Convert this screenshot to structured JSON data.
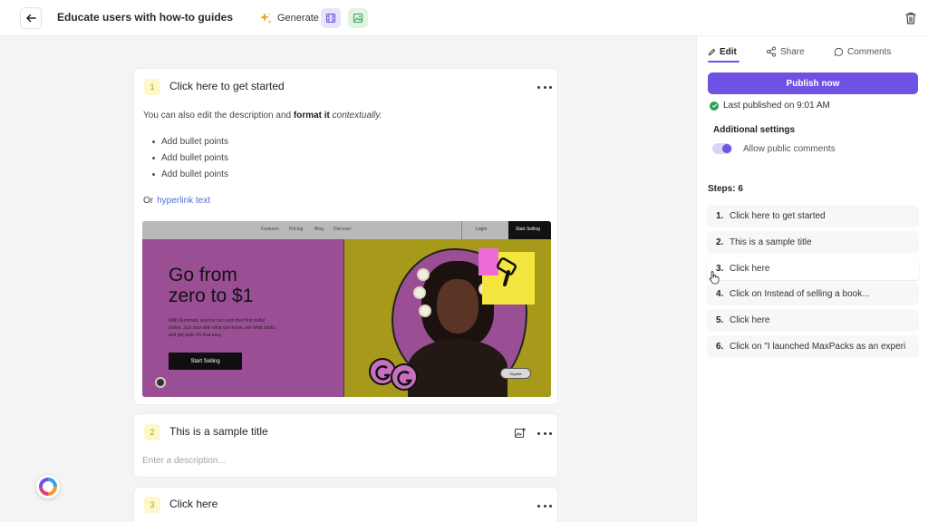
{
  "header": {
    "title": "Educate users with how-to guides",
    "generate_label": "Generate"
  },
  "steps_content": [
    {
      "number": "1",
      "title": "Click here to get started",
      "description_prefix": "You can also edit the description and",
      "description_bold": "format it",
      "description_italic": "contextually.",
      "bullets": [
        "Add bullet points",
        "Add bullet points",
        "Add bullet points"
      ],
      "or_text": "Or",
      "link_text": "hyperlink text",
      "screenshot": {
        "nav_items": [
          "Features",
          "Pricing",
          "Blog",
          "Discover"
        ],
        "login": "Login",
        "start_selling_nav": "Start Selling",
        "headline_line1": "Go from",
        "headline_line2": "zero to $1",
        "body_lines": [
          "With Gumroad, anyone can earn their first dollar",
          "online. Just start with what you know, see what sticks,",
          "and get paid. It's that easy."
        ],
        "cta": "Start Selling",
        "badge": "Gigalife"
      }
    },
    {
      "number": "2",
      "title": "This is a sample title",
      "placeholder": "Enter a description..."
    },
    {
      "number": "3",
      "title": "Click here"
    }
  ],
  "panel": {
    "tabs": [
      "Edit",
      "Share",
      "Comments"
    ],
    "publish_label": "Publish now",
    "last_published": "Last published on 9:01 AM",
    "settings_title": "Additional settings",
    "allow_comments_label": "Allow public comments",
    "allow_comments_enabled": true,
    "steps_label": "Steps: 6",
    "steps": [
      {
        "num": "1.",
        "label": "Click here to get started"
      },
      {
        "num": "2.",
        "label": "This is a sample title"
      },
      {
        "num": "3.",
        "label": "Click here"
      },
      {
        "num": "4.",
        "label": "Click on Instead of selling a book..."
      },
      {
        "num": "5.",
        "label": "Click here"
      },
      {
        "num": "6.",
        "label": "Click on \"I launched MaxPacks as an experi"
      }
    ]
  },
  "colors": {
    "accent": "#6f52e3",
    "success": "#2fa05a",
    "step_badge_bg": "#fdf8cc",
    "link": "#4d6fd6"
  },
  "icons": [
    "back-arrow-icon",
    "sparkle-icon",
    "video-icon",
    "image-icon",
    "trash-icon",
    "pencil-icon",
    "share-icon",
    "comment-icon",
    "check-circle-icon",
    "more-icon",
    "add-image-icon",
    "app-logo-icon",
    "hand-cursor-icon"
  ]
}
